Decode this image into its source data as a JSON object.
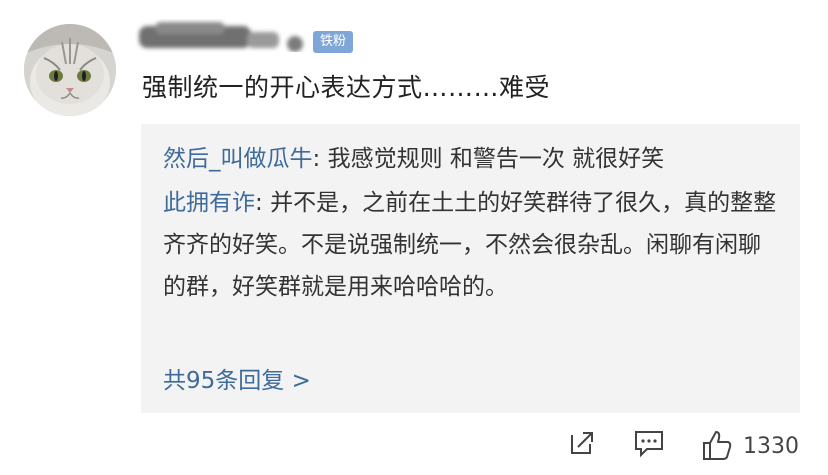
{
  "user": {
    "badge": "铁粉"
  },
  "comment": {
    "text": "强制统一的开心表达方式………难受"
  },
  "replies": [
    {
      "name": "然后_叫做瓜牛",
      "separator": ": ",
      "text": "我感觉规则 和警告一次 就很好笑"
    },
    {
      "name": "此拥有诈",
      "separator": ": ",
      "text": "并不是，之前在土土的好笑群待了很久，真的整整齐齐的好笑。不是说强制统一，不然会很杂乱。闲聊有闲聊的群，好笑群就是用来哈哈哈的。"
    }
  ],
  "more_replies": "共95条回复 >",
  "actions": {
    "share_icon": "share-icon",
    "comment_icon": "comment-icon",
    "like_icon": "thumbs-up-icon",
    "like_count": "1330"
  },
  "colors": {
    "link": "#3f6b9c",
    "badge_bg": "#7ea7d8",
    "reply_bg": "#f3f3f3"
  }
}
